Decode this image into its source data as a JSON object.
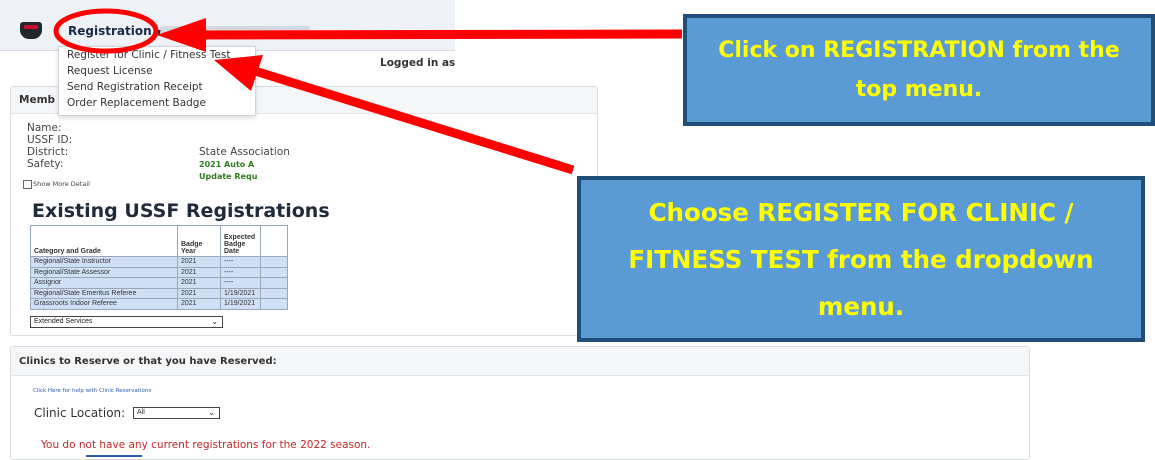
{
  "nav": {
    "registration_label": "Registration",
    "logged_in_label": "Logged in as"
  },
  "dropdown": {
    "items": [
      "Register for Clinic / Fitness Test",
      "Request License",
      "Send Registration Receipt",
      "Order Replacement Badge"
    ]
  },
  "member": {
    "title_visible": "Memb",
    "name_label": "Name:",
    "ussf_label": "USSF ID:",
    "district_label": "District:",
    "state_label": "State Association",
    "safety_label": "Safety:",
    "safety_value_1": "2021 Auto A",
    "safety_value_2": "Update Requ",
    "show_more": "Show More Detail"
  },
  "registrations": {
    "title": "Existing USSF Registrations",
    "headers": [
      "Category and Grade",
      "Badge Year",
      "Expected Badge Date",
      ""
    ],
    "rows": [
      [
        "Regional/State Instructor",
        "2021",
        "----",
        ""
      ],
      [
        "Regional/State Assessor",
        "2021",
        "----",
        ""
      ],
      [
        "Assignor",
        "2021",
        "----",
        ""
      ],
      [
        "Regional/State Emeritus Referee",
        "2021",
        "1/19/2021",
        ""
      ],
      [
        "Grassroots Indoor Referee",
        "2021",
        "1/19/2021",
        ""
      ]
    ],
    "extended_services": "Extended Services"
  },
  "clinics": {
    "title": "Clinics to Reserve or that you have Reserved:",
    "help_link": "Click Here for help with Clinic Reservations",
    "location_label": "Clinic Location:",
    "location_value": "All",
    "no_registrations": "You do not have any current registrations for the 2022 season."
  },
  "callouts": {
    "top": "Click on REGISTRATION from the top menu.",
    "bottom": "Choose REGISTER FOR CLINIC / FITNESS TEST from the dropdown menu."
  },
  "colors": {
    "callout_fill": "#5b9bd5",
    "callout_border": "#1f4e79",
    "callout_text": "#ffff00",
    "annotation_red": "#ff0000",
    "error_text": "#c62828",
    "table_row_fill": "#cfe0f5"
  },
  "icons": {
    "logo": "ussf-referee-logo",
    "nav_caret": "caret-down-icon",
    "select_caret": "chevron-down-icon"
  }
}
